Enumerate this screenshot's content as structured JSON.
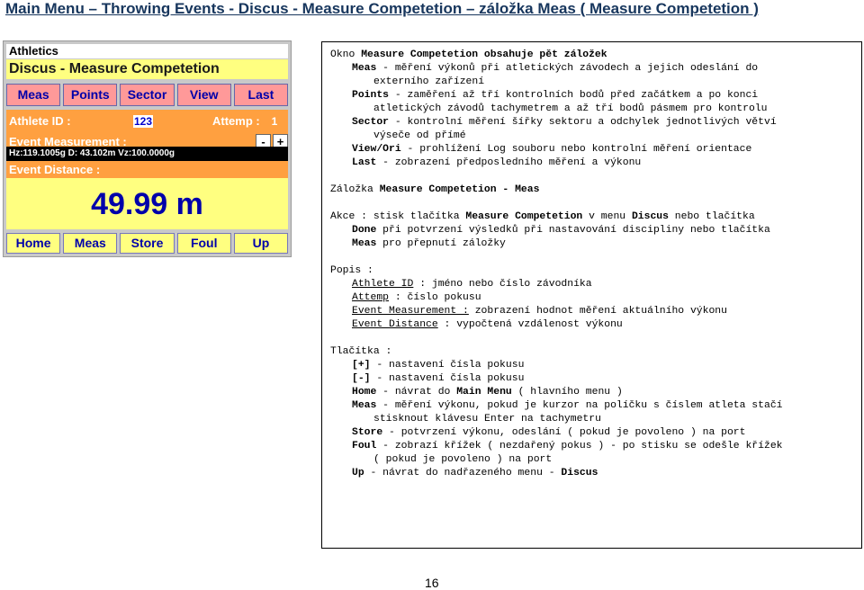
{
  "header": {
    "title": "Main Menu – Throwing Events - Discus - Measure Competetion – záložka  Meas ( Measure Competetion )"
  },
  "device": {
    "app_title": "Athletics",
    "screen_title": "Discus - Measure Competetion",
    "tabs": [
      "Meas",
      "Points",
      "Sector",
      "View",
      "Last"
    ],
    "athlete_label": "Athlete ID :",
    "athlete_value": "123",
    "attempt_label": "Attemp :",
    "attempt_value": "1",
    "event_measurement_label": "Event Measurement :",
    "minus_label": "-",
    "plus_label": "+",
    "status_line": "Hz:119.1005g D: 43.102m Vz:100.0000g",
    "event_distance_label": "Event Distance :",
    "result": "49.99 m",
    "bottom_buttons": [
      "Home",
      "Meas",
      "Store",
      "Foul",
      "Up"
    ]
  },
  "desc": {
    "intro": {
      "p1": "Okno ",
      "b1": "Measure Competetion obsahuje pět záložek",
      "meas_b": "Meas",
      "meas_t": " - měření výkonů při atletických závodech a jejich odeslání do",
      "meas_t2": "externího zařízení",
      "points_b": "Points",
      "points_t": " - zaměření až tří kontrolních bodů před začátkem a po konci",
      "points_t2": "atletických závodů tachymetrem a až tří bodů pásmem pro kontrolu",
      "sector_b": "Sector",
      "sector_t": " - kontrolní měření šířky sektoru a odchylek jednotlivých větví",
      "sector_t2": "výseče od přímé",
      "view_b": "View/Ori",
      "view_t": " - prohlížení Log souboru nebo kontrolní měření orientace",
      "last_b": "Last",
      "last_t": " - zobrazení předposledního měření a výkonu"
    },
    "tab_heading": {
      "t": "Záložka ",
      "b": "Measure Competetion - Meas"
    },
    "akce": {
      "t1": "Akce  : stisk tlačítka ",
      "b1": "Measure Competetion",
      "t2": " v menu ",
      "b2": "Discus",
      "t3": " nebo tlačítka",
      "b3": "Done",
      "t4": " při potvrzení výsledků při nastavování discipliny nebo tlačítka",
      "b4": "Meas",
      "t5": " pro přepnutí záložky"
    },
    "popis": {
      "heading": "Popis :",
      "l1_u": "Athlete ID",
      "l1_t": " : jméno nebo číslo závodníka",
      "l2_u": "Attemp",
      "l2_t": " : číslo pokusu",
      "l3_u": "Event Measurement :",
      "l3_t": " zobrazení hodnot měření aktuálního výkonu",
      "l4_u": "Event Distance",
      "l4_t": " : vypočtená vzdálenost výkonu"
    },
    "buttons": {
      "heading": "Tlačítka :",
      "plus_b": "[+]",
      "plus_t": " - nastavení čísla pokusu",
      "minus_b": "[-]",
      "minus_t": " - nastavení čísla pokusu",
      "home_b": "Home",
      "home_t1": " - návrat do ",
      "home_b2": "Main Menu",
      "home_t2": " ( hlavního menu )",
      "meas_b": "Meas",
      "meas_t": " - měření výkonu, pokud je kurzor na políčku s číslem atleta stačí",
      "meas_t2": "stisknout klávesu Enter na tachymetru",
      "store_b": "Store",
      "store_t": " - potvrzení výkonu, odeslání ( pokud je povoleno ) na port",
      "foul_b": "Foul",
      "foul_t": " - zobrazí křížek ( nezdařený pokus ) - po stisku se odešle křížek",
      "foul_t2": "( pokud je povoleno ) na port",
      "up_b": "Up",
      "up_t": " - návrat do nadřazeného menu - ",
      "up_b2": "Discus"
    }
  },
  "footer": {
    "page_number": "16"
  }
}
